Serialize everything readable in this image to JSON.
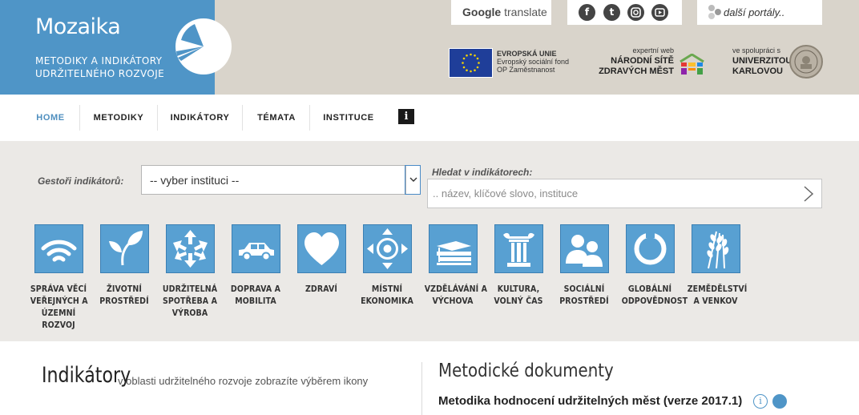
{
  "brand": {
    "title": "Mozaika",
    "subtitle_line1": "METODIKY A INDIKÁTORY",
    "subtitle_line2": "UDRŽITELNÉHO ROZVOJE"
  },
  "topbar": {
    "translate_google": "Google",
    "translate_rest": " translate",
    "social": [
      "facebook-icon",
      "twitter-icon",
      "instagram-icon",
      "youtube-icon"
    ],
    "portals_label": "další portály.."
  },
  "partners": {
    "eu_line1": "EVROPSKÁ UNIE",
    "eu_line2": "Evropský sociální fond",
    "eu_line3": "OP Zaměstnanost",
    "nszm_small": "expertní web",
    "nszm_line1": "NÁRODNÍ SÍTĚ",
    "nszm_line2": "ZDRAVÝCH MĚST",
    "uk_small": "ve spolupráci s",
    "uk_line1": "UNIVERZITOU",
    "uk_line2": "KARLOVOU"
  },
  "nav": {
    "items": [
      "HOME",
      "METODIKY",
      "INDIKÁTORY",
      "TÉMATA",
      "INSTITUCE"
    ],
    "info_label": "i"
  },
  "filters": {
    "gestor_label": "Gestoři indikátorů:",
    "gestor_value": "-- vyber instituci --",
    "search_label": "Hledat v indikátorech:",
    "search_placeholder": ".. název, klíčové slovo, instituce"
  },
  "themes": [
    {
      "line1": "SPRÁVA VĚCÍ",
      "line2": "VEŘEJNÝCH A",
      "line3": "ÚZEMNÍ",
      "line4": "ROZVOJ",
      "icon": "wifi-icon"
    },
    {
      "line1": "ŽIVOTNÍ",
      "line2": "PROSTŘEDÍ",
      "line3": "",
      "line4": "",
      "icon": "leaf-icon"
    },
    {
      "line1": "UDRŽITELNÁ",
      "line2": "SPOTŘEBA A",
      "line3": "VÝROBA",
      "line4": "",
      "icon": "recycle-arrows-icon"
    },
    {
      "line1": "DOPRAVA A",
      "line2": "MOBILITA",
      "line3": "",
      "line4": "",
      "icon": "car-icon"
    },
    {
      "line1": "ZDRAVÍ",
      "line2": "",
      "line3": "",
      "line4": "",
      "icon": "heart-icon"
    },
    {
      "line1": "MÍSTNÍ",
      "line2": "EKONOMIKA",
      "line3": "",
      "line4": "",
      "icon": "compass-arrows-icon"
    },
    {
      "line1": "VZDĚLÁVÁNÍ A",
      "line2": "VÝCHOVA",
      "line3": "",
      "line4": "",
      "icon": "books-icon"
    },
    {
      "line1": "KULTURA,",
      "line2": "VOLNÝ ČAS",
      "line3": "",
      "line4": "",
      "icon": "column-icon"
    },
    {
      "line1": "SOCIÁLNÍ",
      "line2": "PROSTŘEDÍ",
      "line3": "",
      "line4": "",
      "icon": "people-icon"
    },
    {
      "line1": "GLOBÁLNÍ",
      "line2": "ODPOVĚDNOST",
      "line3": "",
      "line4": "",
      "icon": "globe-ring-icon"
    },
    {
      "line1": "ZEMĚDĚLSTVÍ",
      "line2": "A VENKOV",
      "line3": "",
      "line4": "",
      "icon": "wheat-icon"
    }
  ],
  "content": {
    "indicators_title": "Indikátory",
    "indicators_sub": "v oblasti udržitelného rozvoje zobrazíte výběrem ikony",
    "methods_title": "Metodické dokumenty",
    "methods_slash": "/",
    "doc_title": "Metodika hodnocení udržitelných měst (verze 2017.1)",
    "doc_info": "i"
  },
  "colors": {
    "brand_blue": "#4f95c7",
    "tile_blue": "#58a0d2",
    "header_bg": "#d9d4cb",
    "panel_bg": "#ebe9e6"
  }
}
